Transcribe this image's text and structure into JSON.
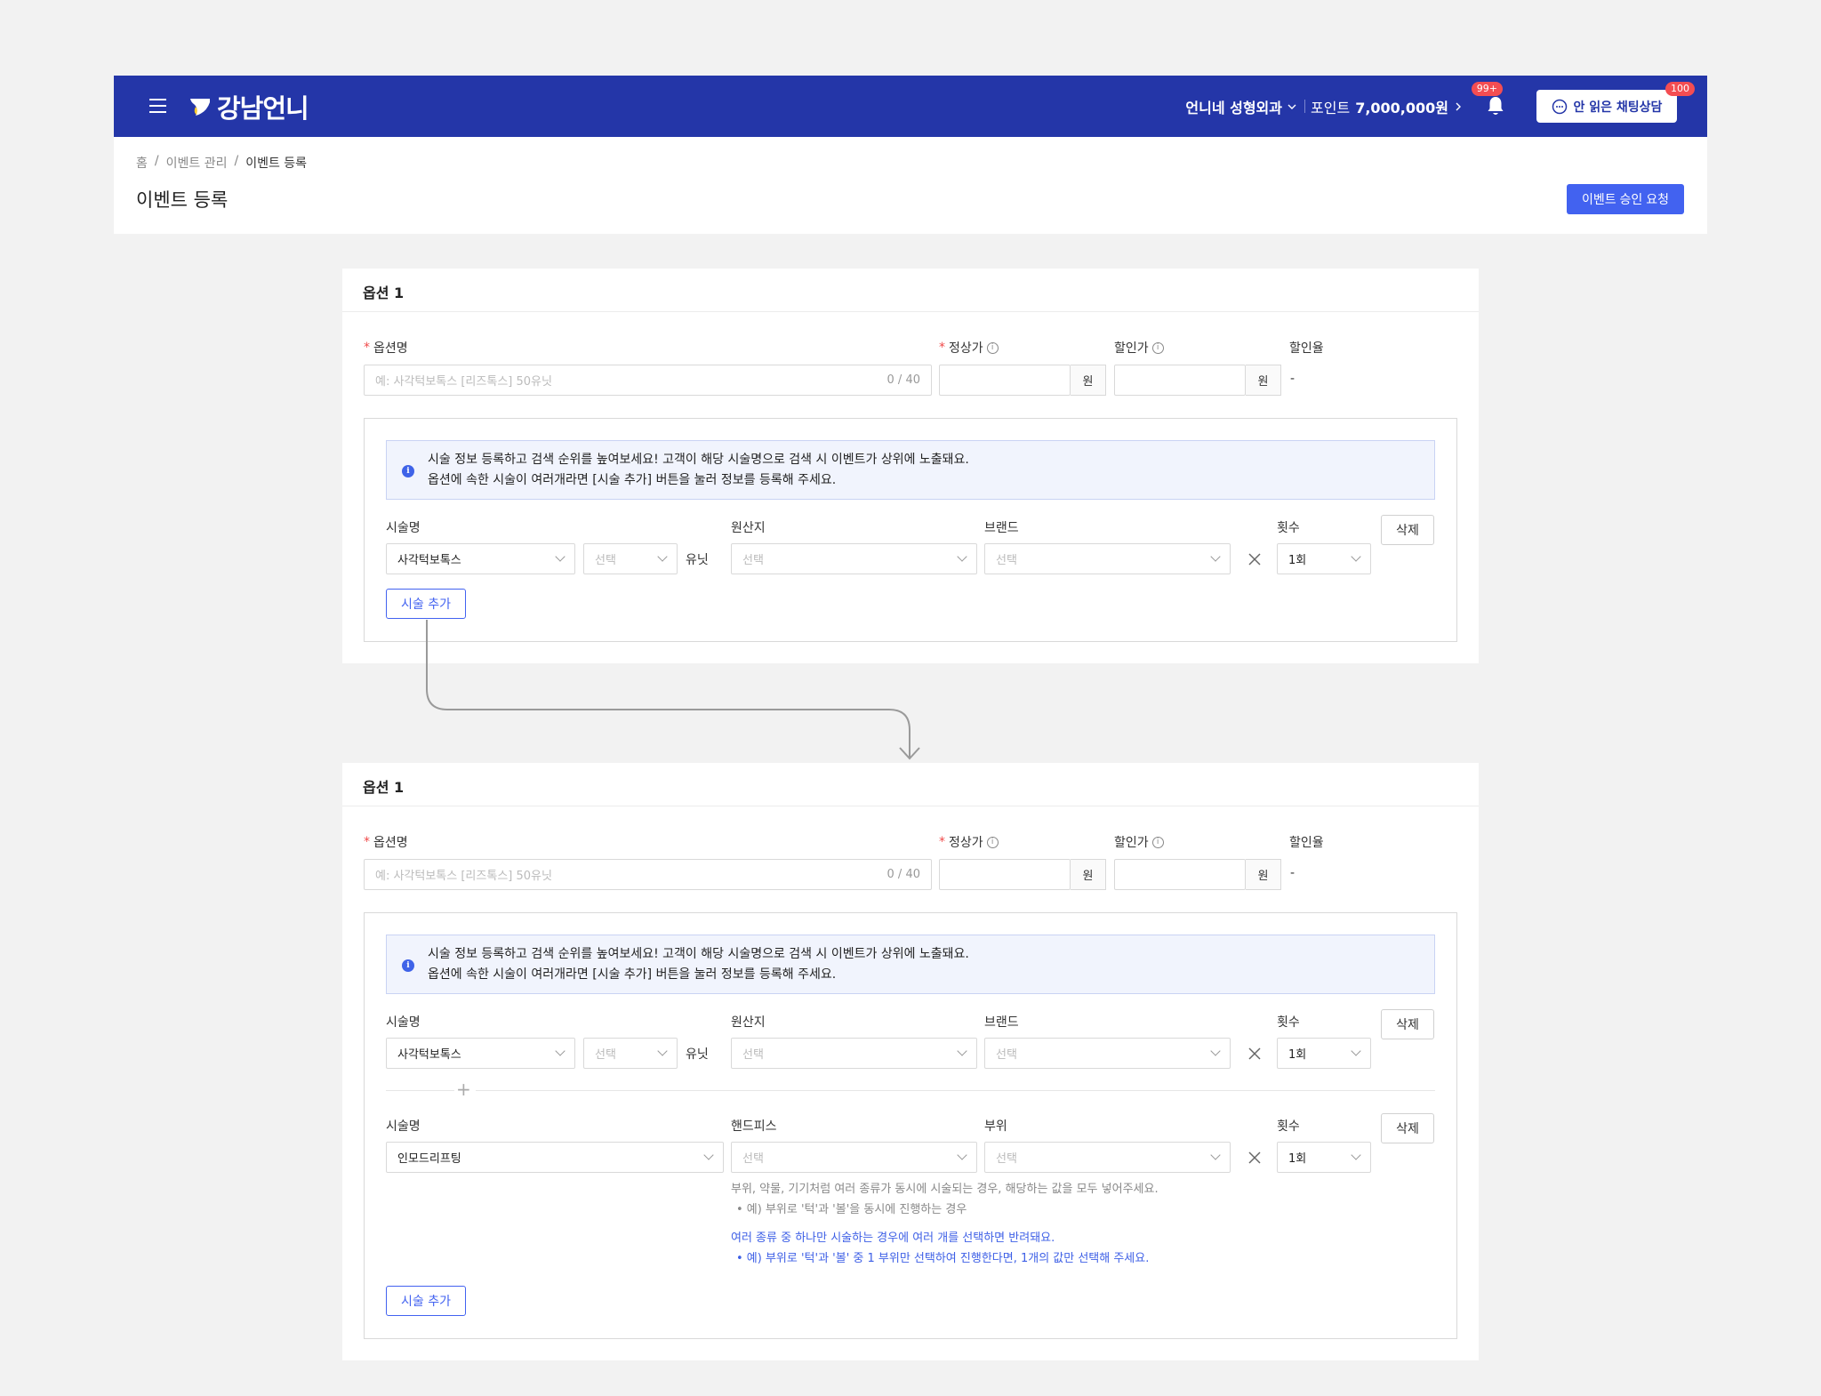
{
  "header": {
    "logo_text": "강남언니",
    "clinic_name": "언니네 성형외과",
    "points_label": "포인트",
    "points_value": "7,000,000원",
    "notification_badge": "99+",
    "chat_button_label": "안 읽은 채팅상담",
    "chat_badge": "100",
    "bg_color": "#2436a8"
  },
  "breadcrumb": [
    "홈",
    "/",
    "이벤트 관리",
    "/",
    "이벤트 등록"
  ],
  "page_title": "이벤트 등록",
  "approve_button": "이벤트 승인 요청",
  "form": {
    "option_title": "옵션 1",
    "option_name_label": "옵션명",
    "option_name_placeholder": "예: 사각턱보톡스 [리즈톡스] 50유닛",
    "option_name_count": "0 / 40",
    "regular_price_label": "정상가",
    "discount_price_label": "할인가",
    "discount_rate_label": "할인율",
    "currency_unit": "원",
    "discount_rate_value": "-",
    "required_mark": "*",
    "info_mark": "i"
  },
  "notice": {
    "line1": "시술 정보 등록하고 검색 순위를 높여보세요! 고객이 해당 시술명으로 검색 시 이벤트가 상위에 노출돼요.",
    "line2": "옵션에 속한 시술이 여러개라면 [시술 추가] 버튼을 눌러 정보를 등록해 주세요."
  },
  "procedure1": {
    "name_label": "시술명",
    "name_value": "사각턱보톡스",
    "amount_placeholder": "선택",
    "amount_unit": "유닛",
    "origin_label": "원산지",
    "origin_placeholder": "선택",
    "brand_label": "브랜드",
    "brand_placeholder": "선택",
    "count_label": "횟수",
    "count_value": "1회",
    "delete_label": "삭제"
  },
  "procedure2": {
    "name_label": "시술명",
    "name_value": "인모드리프팅",
    "handpiece_label": "핸드피스",
    "handpiece_placeholder": "선택",
    "area_label": "부위",
    "area_placeholder": "선택",
    "count_label": "횟수",
    "count_value": "1회",
    "delete_label": "삭제"
  },
  "help": {
    "gray_line": "부위, 약물, 기기처럼 여러 종류가 동시에 시술되는 경우, 해당하는 값을 모두 넣어주세요.",
    "gray_bullet": "•  예) 부위로 '턱'과 '볼'을 동시에 진행하는 경우",
    "blue_line": "여러 종류 중 하나만 시술하는 경우에 여러 개를 선택하면 반려돼요.",
    "blue_bullet": "•  예) 부위로 '턱'과 '볼' 중 1 부위만 선택하여 진행한다면, 1개의 값만 선택해 주세요."
  },
  "add_procedure_label": "시술 추가",
  "accent_color": "#4262f0"
}
